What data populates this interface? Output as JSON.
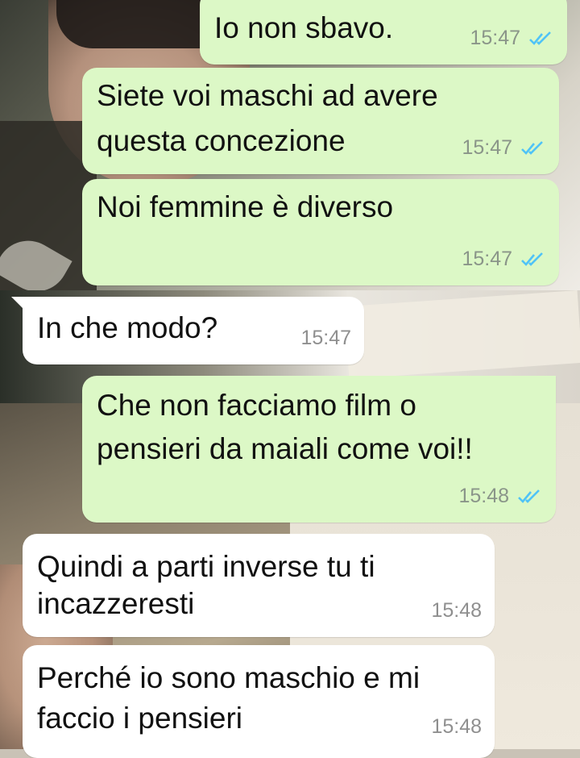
{
  "chat": {
    "messages": [
      {
        "direction": "out",
        "lines": [
          "Io non sbavo."
        ],
        "time": "15:47",
        "status_icon": "double-check-read-icon"
      },
      {
        "direction": "out",
        "lines": [
          "Siete voi maschi ad avere",
          "questa concezione"
        ],
        "time": "15:47",
        "status_icon": "double-check-read-icon"
      },
      {
        "direction": "out",
        "lines": [
          "Noi femmine è diverso"
        ],
        "time": "15:47",
        "status_icon": "double-check-read-icon"
      },
      {
        "direction": "in",
        "lines": [
          "In che modo?"
        ],
        "time": "15:47"
      },
      {
        "direction": "out",
        "lines": [
          "Che non facciamo film o",
          "pensieri da maiali come voi!!"
        ],
        "time": "15:48",
        "status_icon": "double-check-read-icon"
      },
      {
        "direction": "in",
        "lines": [
          "Quindi a parti inverse tu ti",
          "incazzeresti"
        ],
        "time": "15:48"
      },
      {
        "direction": "in",
        "lines": [
          "Perché io sono maschio e mi",
          "faccio i pensieri"
        ],
        "time": "15:48"
      }
    ]
  },
  "colors": {
    "outgoing_bubble": "#dcf8c6",
    "incoming_bubble": "#ffffff",
    "read_ticks": "#4fc3f7"
  }
}
